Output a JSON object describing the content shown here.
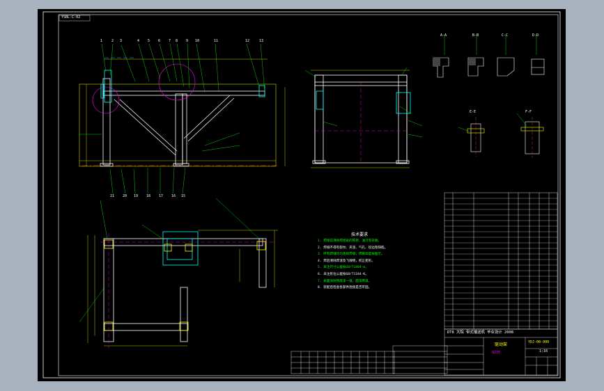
{
  "drawing_tag": "YSBL-C-02",
  "balloons_top": [
    "1",
    "2",
    "3",
    "4",
    "5",
    "6",
    "7",
    "8",
    "9",
    "10",
    "11",
    "12",
    "13"
  ],
  "balloons_bottom": [
    "21",
    "20",
    "19",
    "18",
    "17",
    "16",
    "15"
  ],
  "section_labels": [
    "A-A",
    "B-B",
    "C-C",
    "D-D",
    "E-E",
    "F-F"
  ],
  "tech_req_title": "技术要求",
  "tech_req_lines": [
    "1. 焊接前清除焊接处的铁锈、油污等杂质。",
    "2. 焊缝不得有裂纹、夹渣、气孔、咬边等缺陷。",
    "3. 所有焊缝均为连续焊缝，焊脚高度按图示。",
    "4. 焊后清除焊渣及飞溅物，校正变形。",
    "5. 未注尺寸公差按GB/T1804-m。",
    "6. 未注形位公差按GB/T1184-K。",
    "7. 表面涂防锈底漆一道，面漆两道。",
    "8. 装配后检查各部件连接是否牢固。"
  ],
  "title_block": {
    "university": "DT8 大院 带式输送机 毕业设计 2008",
    "drawing_name": "驱动架",
    "drawing_no": "YDJ-00-000",
    "material": "Q235",
    "scale": "1:10"
  }
}
